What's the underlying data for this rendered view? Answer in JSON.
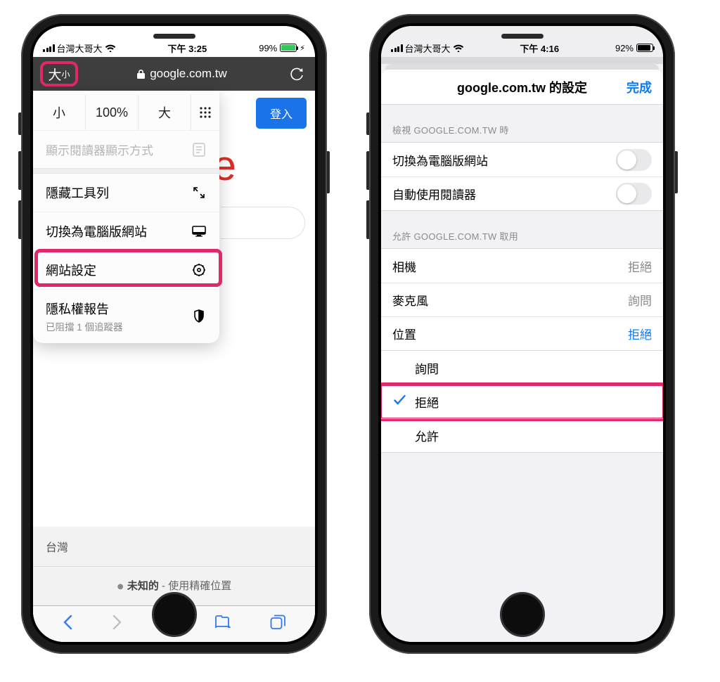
{
  "phone1": {
    "status": {
      "carrier": "台灣大哥大",
      "time": "下午 3:25",
      "battery_pct": "99%"
    },
    "address": {
      "aa_big": "大",
      "aa_small": "小",
      "url": "google.com.tw"
    },
    "login_button": "登入",
    "google_letter": "e",
    "popover": {
      "zoom_small": "小",
      "zoom_pct": "100%",
      "zoom_big": "大",
      "reader": "顯示閱讀器顯示方式",
      "items": {
        "hide_toolbar": "隱藏工具列",
        "desktop_site": "切換為電腦版網站",
        "site_settings": "網站設定",
        "privacy": "隱私權報告",
        "privacy_sub": "已阻擋 1 個追蹤器"
      }
    },
    "footer": {
      "region": "台灣",
      "location_unknown": "未知的",
      "location_suffix": " - 使用精確位置"
    }
  },
  "phone2": {
    "status": {
      "carrier": "台灣大哥大",
      "time": "下午 4:16",
      "battery_pct": "92%"
    },
    "nav": {
      "title": "google.com.tw 的設定",
      "done": "完成"
    },
    "section_view_header": "檢視 GOOGLE.COM.TW 時",
    "view_rows": {
      "desktop_site": "切換為電腦版網站",
      "auto_reader": "自動使用閱讀器"
    },
    "section_allow_header": "允許 GOOGLE.COM.TW 取用",
    "perm_rows": {
      "camera": {
        "label": "相機",
        "value": "拒絕"
      },
      "microphone": {
        "label": "麥克風",
        "value": "詢問"
      },
      "location": {
        "label": "位置",
        "value": "拒絕"
      }
    },
    "location_options": {
      "ask": "詢問",
      "deny": "拒絕",
      "allow": "允許"
    }
  }
}
